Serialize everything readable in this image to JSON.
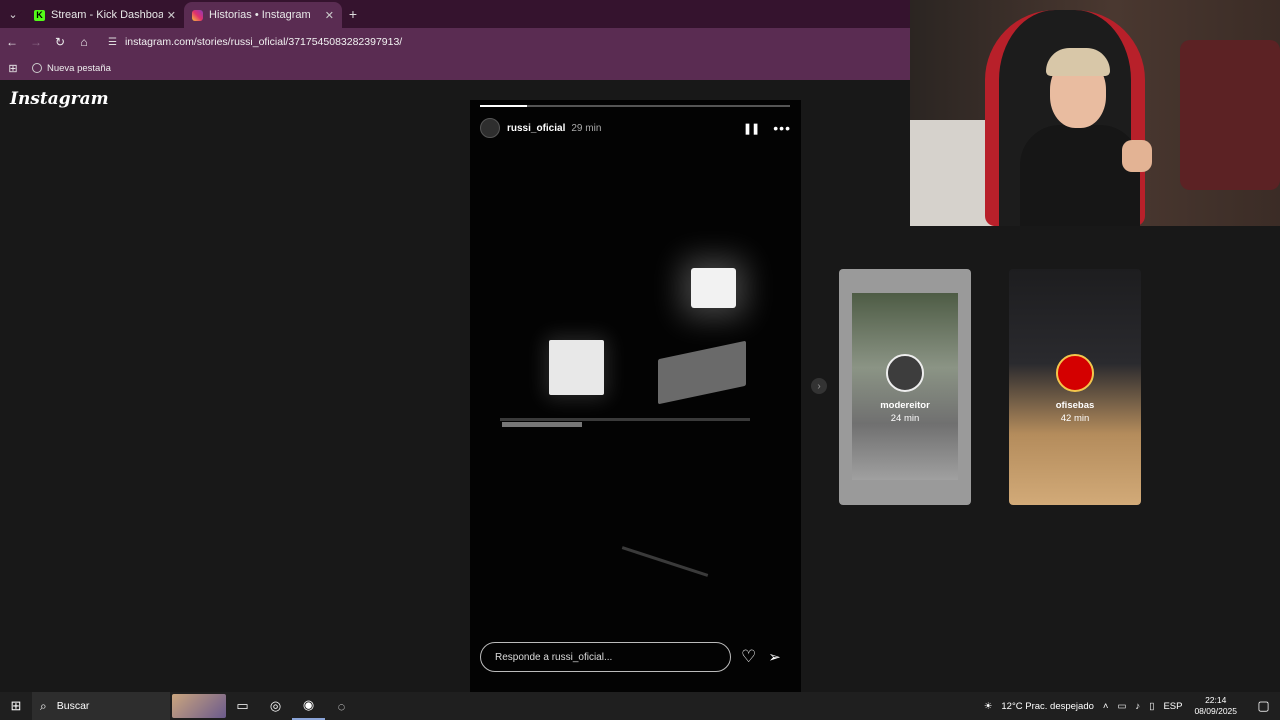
{
  "browser": {
    "tabs": [
      {
        "title": "Stream - Kick Dashboard",
        "favicon": "kick-icon",
        "active": false
      },
      {
        "title": "Historias • Instagram",
        "favicon": "instagram-icon",
        "active": true
      }
    ],
    "url": "instagram.com/stories/russi_oficial/3717545083282397913/",
    "bookmarks": [
      {
        "label": "Nueva pestaña"
      }
    ]
  },
  "instagram": {
    "logo": "Instagram",
    "story": {
      "username": "russi_oficial",
      "time": "29 min",
      "progress": 0.15,
      "reply_placeholder": "Responde a russi_oficial..."
    },
    "previews": [
      {
        "username": "modereitor",
        "time": "24 min"
      },
      {
        "username": "ofisebas",
        "time": "42 min"
      }
    ]
  },
  "taskbar": {
    "search_label": "Buscar",
    "weather": "12°C  Prac. despejado",
    "language": "ESP",
    "time": "22:14",
    "date": "08/09/2025"
  },
  "colors": {
    "tabbar": "#35132e",
    "toolbar": "#5a2c52",
    "page_bg": "#181818"
  }
}
